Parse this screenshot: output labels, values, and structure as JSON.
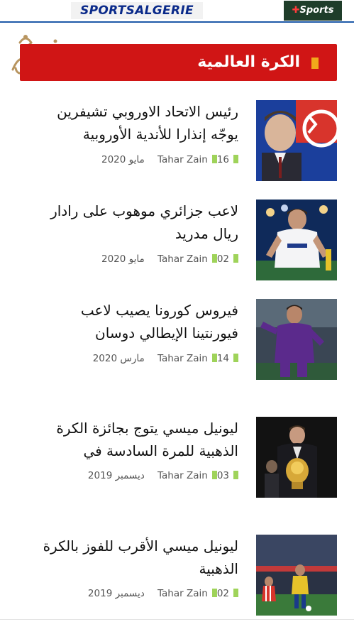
{
  "topbar": {
    "brand_left": "SPORTSALGERIE",
    "brand_right": "Sports"
  },
  "section": {
    "title": "الكرة العالمية"
  },
  "articles": [
    {
      "headline_line1": "رئيس الاتحاد الاوروبي تشيفرين",
      "headline_line2": "يوجّه إنذارا للأندية الأوروبية",
      "author": "Tahar Zain",
      "date": "16 مايو 2020",
      "image": "uefa-president-photo"
    },
    {
      "headline_line1": "لاعب جزائري موهوب على رادار",
      "headline_line2": "ريال مدريد",
      "author": "Tahar Zain",
      "date": "02 مايو 2020",
      "image": "lyon-player-photo"
    },
    {
      "headline_line1": "فيروس كورونا يصيب لاعب",
      "headline_line2": "فيورنتينا الإيطالي دوسان",
      "author": "Tahar Zain",
      "date": "14 مارس 2020",
      "image": "fiorentina-player-photo"
    },
    {
      "headline_line1": "ليونيل ميسي يتوج بجائزة الكرة",
      "headline_line2": "الذهبية للمرة السادسة في",
      "author": "Tahar Zain",
      "date": "03 ديسمبر 2019",
      "image": "messi-ballon-dor-photo"
    },
    {
      "headline_line1": "ليونيل ميسي الأقرب للفوز بالكرة",
      "headline_line2": "الذهبية",
      "author": "Tahar Zain",
      "date": "02 ديسمبر 2019",
      "image": "messi-barcelona-photo"
    }
  ],
  "colors": {
    "header_red": "#d01515",
    "marker_orange": "#f1a81b",
    "meta_marker_green": "#9fd35a",
    "brand_blue": "#0a2a8a"
  }
}
